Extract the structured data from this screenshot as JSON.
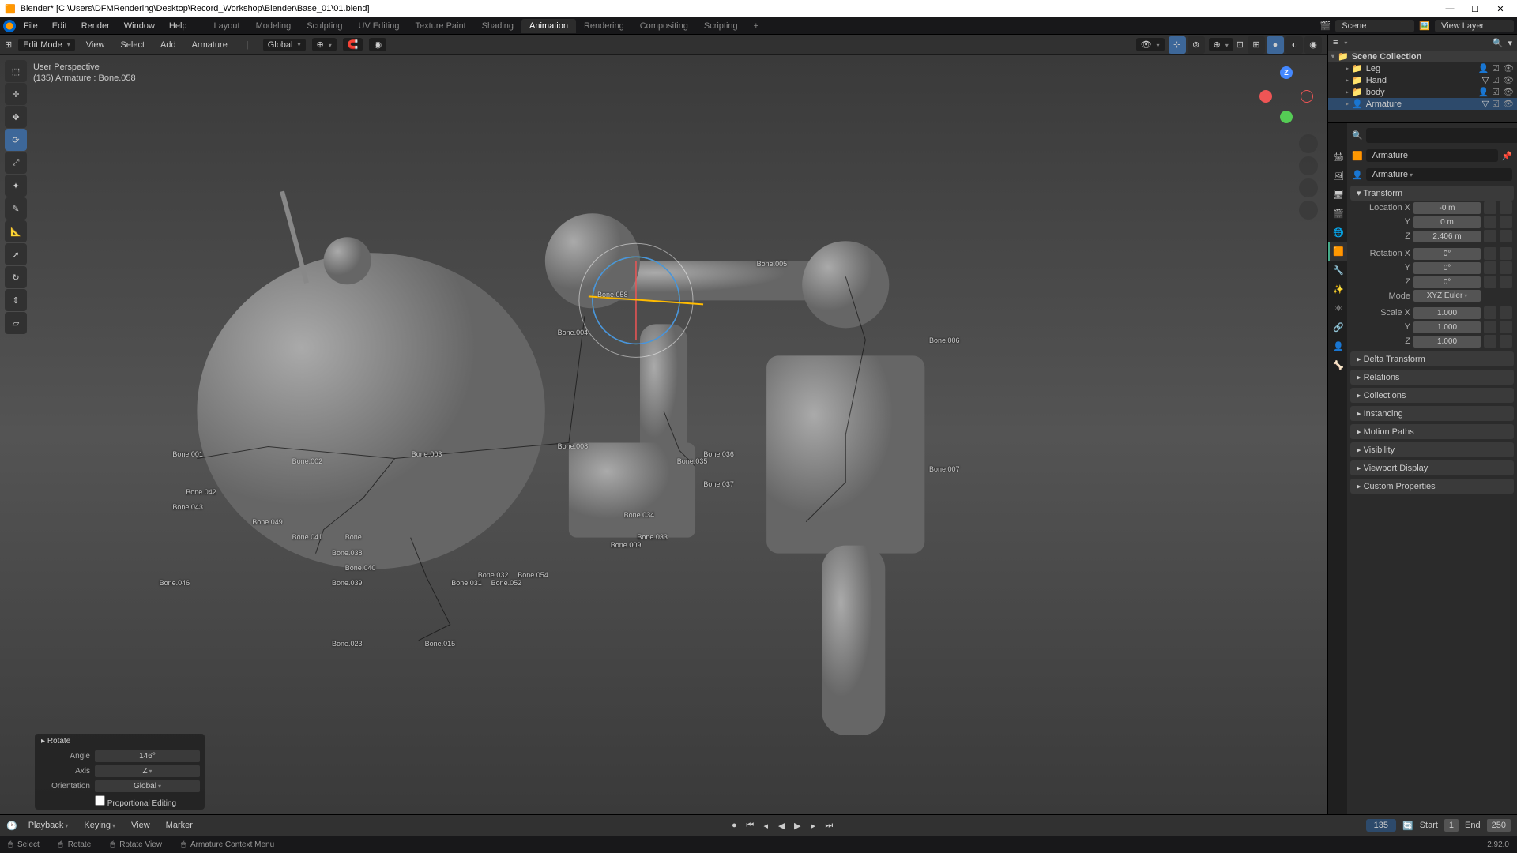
{
  "titlebar": {
    "text": "Blender* [C:\\Users\\DFMRendering\\Desktop\\Record_Workshop\\Blender\\Base_01\\01.blend]"
  },
  "menu": {
    "items": [
      "File",
      "Edit",
      "Render",
      "Window",
      "Help"
    ],
    "workspaces": [
      "Layout",
      "Modeling",
      "Sculpting",
      "UV Editing",
      "Texture Paint",
      "Shading",
      "Animation",
      "Rendering",
      "Compositing",
      "Scripting"
    ],
    "active_ws": "Animation",
    "scene_label": "Scene",
    "viewlayer_label": "View Layer"
  },
  "vphdr": {
    "mode": "Edit Mode",
    "menus": [
      "View",
      "Select",
      "Add",
      "Armature"
    ],
    "pivot": "Global"
  },
  "overlay": {
    "line1": "User Perspective",
    "line2": "(135) Armature : Bone.058"
  },
  "opbox": {
    "title": "Rotate",
    "rows": [
      {
        "label": "Angle",
        "value": "146°"
      },
      {
        "label": "Axis",
        "value": "Z"
      },
      {
        "label": "Orientation",
        "value": "Global"
      }
    ],
    "prop_edit": "Proportional Editing"
  },
  "outliner": {
    "root": "Scene Collection",
    "items": [
      {
        "name": "Leg",
        "icon": "📦"
      },
      {
        "name": "Hand",
        "icon": "📦"
      },
      {
        "name": "body",
        "icon": "📦"
      },
      {
        "name": "Armature",
        "icon": "🦴",
        "selected": true
      }
    ]
  },
  "props": {
    "context_name": "Armature",
    "breadcrumb": "Armature",
    "transform": {
      "title": "Transform",
      "location": {
        "label": "Location X",
        "x": "-0 m",
        "y": "0 m",
        "z": "2.406 m"
      },
      "rotation": {
        "label": "Rotation X",
        "x": "0°",
        "y": "0°",
        "z": "0°"
      },
      "mode_label": "Mode",
      "mode": "XYZ Euler",
      "scale": {
        "label": "Scale X",
        "x": "1.000",
        "y": "1.000",
        "z": "1.000"
      }
    },
    "panels": [
      "Delta Transform",
      "Relations",
      "Collections",
      "Instancing",
      "Motion Paths",
      "Visibility",
      "Viewport Display",
      "Custom Properties"
    ]
  },
  "timeline": {
    "menus": [
      "Playback",
      "Keying",
      "View",
      "Marker"
    ],
    "current": "135",
    "start_label": "Start",
    "start": "1",
    "end_label": "End",
    "end": "250"
  },
  "status": {
    "items": [
      "Select",
      "Rotate",
      "Rotate View",
      "Armature Context Menu"
    ],
    "version": "2.92.0"
  },
  "bones": [
    "Bone.005",
    "Bone.058",
    "Bone.004",
    "Bone.006",
    "Bone.001",
    "Bone.002",
    "Bone.003",
    "Bone.007",
    "Bone.008",
    "Bone.033",
    "Bone.034",
    "Bone.035",
    "Bone.036",
    "Bone.037",
    "Bone.009",
    "Bone.032",
    "Bone.054",
    "Bone.052",
    "Bone.031",
    "Bone.038",
    "Bone.041",
    "Bone.042",
    "Bone.043",
    "Bone.049",
    "Bone.040",
    "Bone.039",
    "Bone.046",
    "Bone.015",
    "Bone.023",
    "Bone"
  ]
}
